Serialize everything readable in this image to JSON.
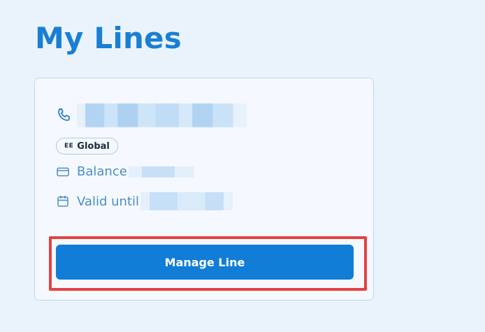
{
  "page": {
    "title": "My Lines"
  },
  "card": {
    "phone": {
      "icon": "phone-icon",
      "number_redacted": true
    },
    "network_badge": {
      "logo": "EE",
      "label": "Global"
    },
    "balance": {
      "icon": "credit-card-icon",
      "label": "Balance",
      "value_redacted": true
    },
    "validity": {
      "icon": "calendar-icon",
      "label": "Valid until",
      "value_redacted": true
    },
    "manage_button": {
      "label": "Manage Line"
    }
  },
  "colors": {
    "background": "#eaf3fc",
    "title": "#1a7fd4",
    "card_background": "#f5f9ff",
    "card_border": "#b9d9f2",
    "info_text": "#4a8ec4",
    "button": "#127dd6",
    "highlight": "#e84040"
  }
}
